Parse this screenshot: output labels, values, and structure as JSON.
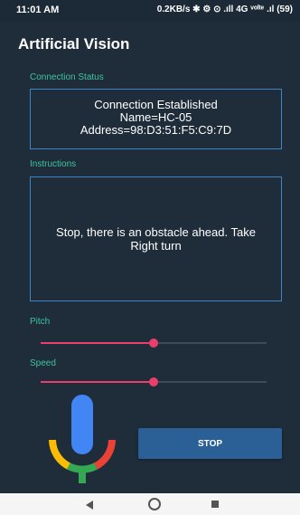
{
  "status_bar": {
    "time": "11:01 AM",
    "indicators": "0.2KB/s ✱ ⚙ ⊙ .ıll 4G ᵛᵒˡᵗᵉ .ıl (59)"
  },
  "app_bar": {
    "title": "Artificial Vision"
  },
  "connection": {
    "label": "Connection Status",
    "line1": "Connection Established",
    "line2": "Name=HC-05",
    "line3": "Address=98:D3:51:F5:C9:7D"
  },
  "instructions": {
    "label": "Instructions",
    "text": "Stop, there is an obstacle ahead. Take Right turn"
  },
  "pitch": {
    "label": "Pitch",
    "value_percent": 50
  },
  "speed": {
    "label": "Speed",
    "value_percent": 50
  },
  "mic": {
    "icon": "microphone-icon",
    "colors": [
      "#4285f4",
      "#ea4335",
      "#fbbc05",
      "#34a853"
    ]
  },
  "stop_button": {
    "label": "STOP"
  },
  "nav": {
    "back_icon": "back-icon",
    "home_icon": "home-icon",
    "recent_icon": "recent-apps-icon"
  },
  "colors": {
    "accent": "#3ec39e",
    "slider": "#ec3e6d",
    "box_border": "#3d86c6",
    "button": "#2b6096"
  }
}
